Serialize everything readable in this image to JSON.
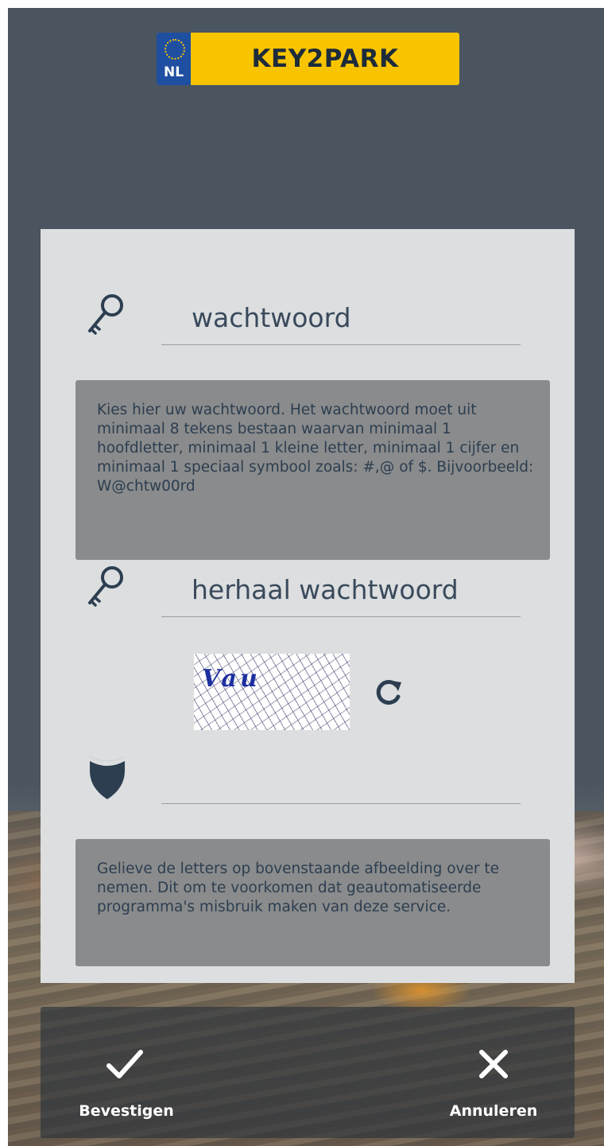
{
  "logo": {
    "country_code": "NL",
    "brand": "KEY2PARK"
  },
  "password": {
    "placeholder": "wachtwoord"
  },
  "password_hint": "Kies hier uw wachtwoord. Het wachtwoord moet uit minimaal 8 tekens bestaan waarvan minimaal 1 hoofdletter, minimaal 1 kleine letter, minimaal 1 cijfer en minimaal 1 speciaal symbool zoals: #,@ of $. Bijvoorbeeld: W@chtw00rd",
  "repeat_password": {
    "placeholder": "herhaal wachtwoord"
  },
  "captcha": {
    "text": "Vau",
    "input_value": ""
  },
  "captcha_hint": "Gelieve de letters op bovenstaande afbeelding over te nemen. Dit om te voorkomen dat geautomatiseerde programma's misbruik maken van deze service.",
  "actions": {
    "confirm_label": "Bevestigen",
    "cancel_label": "Annuleren"
  },
  "icons": {
    "password": "key-icon",
    "repeat_password": "key-icon",
    "captcha_field": "shield-icon",
    "refresh": "refresh-icon",
    "confirm": "checkmark-icon",
    "cancel": "close-icon"
  },
  "colors": {
    "brand_yellow": "#f8c400",
    "eu_blue": "#1f4fa0",
    "text": "#3a4a5c",
    "hint_bg": "#8a8b8c"
  }
}
